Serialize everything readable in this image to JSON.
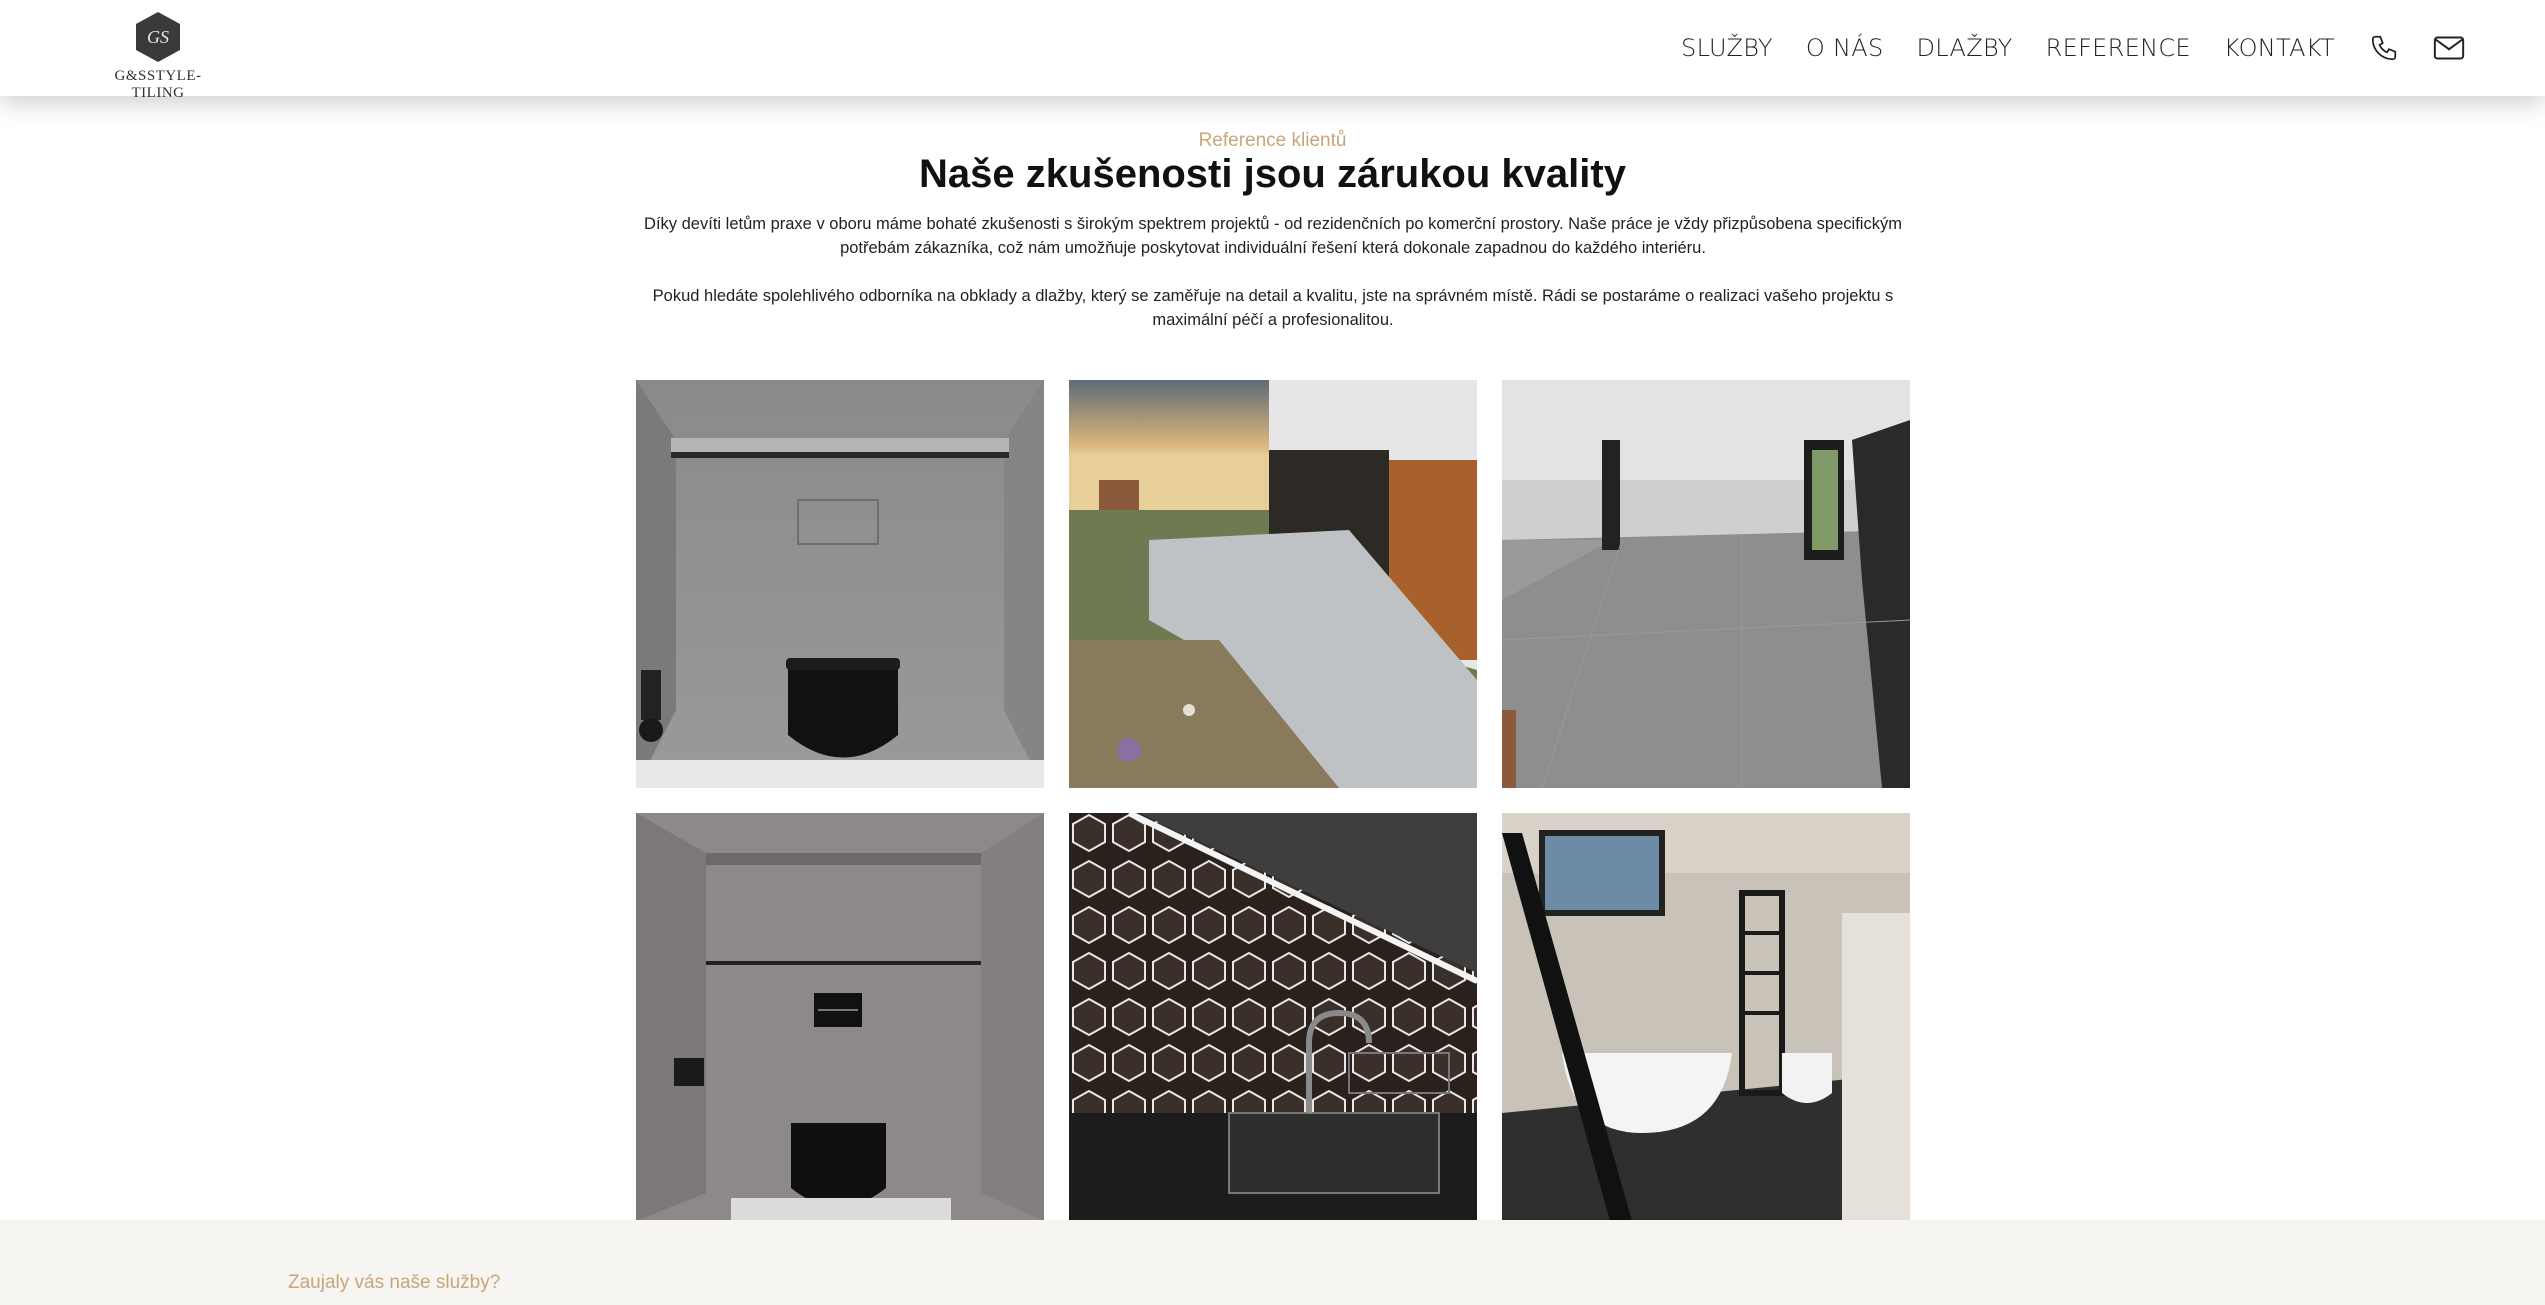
{
  "brand": {
    "logo_monogram": "GS",
    "name": "G&SSTYLE-TILING"
  },
  "nav": {
    "items": [
      {
        "label": "SLUŽBY"
      },
      {
        "label": "O NÁS"
      },
      {
        "label": "DLAŽBY"
      },
      {
        "label": "REFERENCE"
      },
      {
        "label": "KONTAKT"
      }
    ],
    "icons": [
      "phone-icon",
      "mail-icon"
    ]
  },
  "references": {
    "eyebrow": "Reference klientů",
    "title": "Naše zkušenosti jsou zárukou kvality",
    "paragraph1": "Díky devíti letům praxe v oboru máme bohaté zkušenosti s širokým spektrem projektů - od rezidenčních po komerční prostory. Naše práce je vždy přizpůsobena specifickým potřebám zákazníka, což nám umožňuje poskytovat individuální řešení která dokonale zapadnou do každého interiéru.",
    "paragraph2": "Pokud hledáte spolehlivého odborníka na obklady a dlažby, který se zaměřuje na detail a kvalitu, jste na správném místě. Rádi se postaráme o realizaci vašeho projektu s maximální péčí a profesionalitou.",
    "photos": [
      "toilet-grey-tiles-photo",
      "exterior-terrace-photo",
      "empty-room-floor-photo",
      "toilet-black-flush-photo",
      "kitchen-hex-backsplash-photo",
      "bathroom-bathtub-photo"
    ]
  },
  "cta": {
    "eyebrow": "Zaujaly vás naše služby?"
  },
  "colors": {
    "accent": "#c9a57a",
    "text": "#111111",
    "bottom_bg": "#f6f5f2"
  }
}
